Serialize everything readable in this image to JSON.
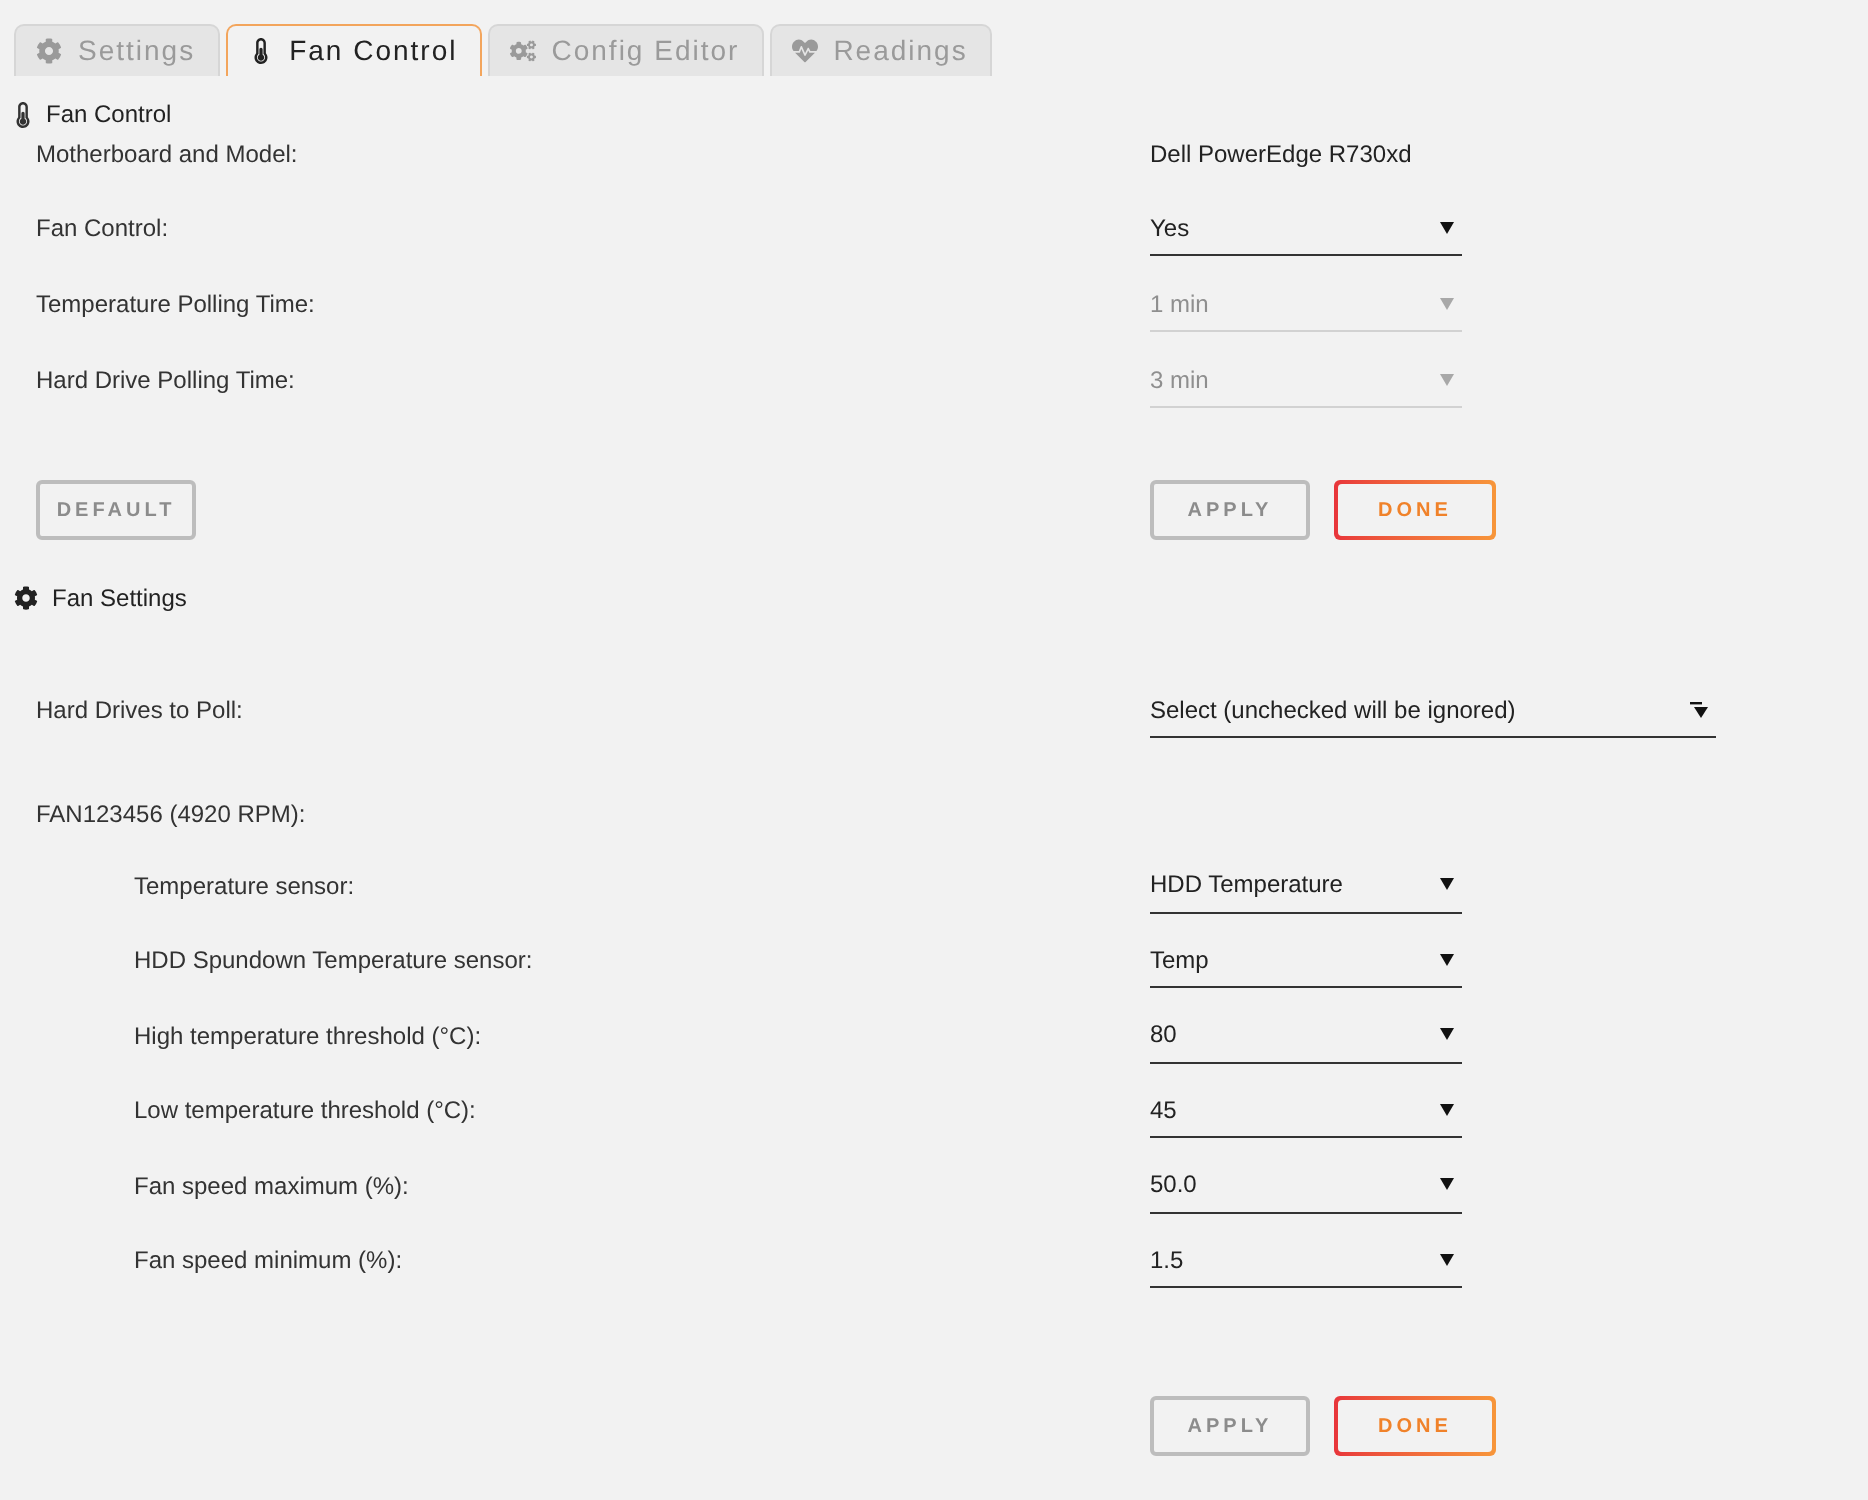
{
  "tabs": [
    {
      "label": "Settings",
      "selected": false
    },
    {
      "label": "Fan Control",
      "selected": true
    },
    {
      "label": "Config Editor",
      "selected": false
    },
    {
      "label": "Readings",
      "selected": false
    }
  ],
  "fan_control": {
    "title": "Fan Control",
    "fields": [
      {
        "kind": "text",
        "label": "Motherboard and Model:",
        "value": "Dell PowerEdge R730xd"
      },
      {
        "kind": "select",
        "label": "Fan Control:",
        "value": "Yes",
        "disabled": false
      },
      {
        "kind": "select",
        "label": "Temperature Polling Time:",
        "value": "1 min",
        "disabled": true
      },
      {
        "kind": "select",
        "label": "Hard Drive Polling Time:",
        "value": "3 min",
        "disabled": true
      }
    ],
    "left_buttons": [
      {
        "label": "DEFAULT",
        "disabled": true
      }
    ],
    "right_buttons": [
      {
        "label": "APPLY",
        "disabled": true
      },
      {
        "label": "DONE",
        "disabled": false
      }
    ]
  },
  "fan_settings": {
    "title": "Fan Settings",
    "hard_drives": {
      "label": "Hard Drives to Poll:",
      "value": "Select (unchecked will be ignored)"
    },
    "fans": [
      {
        "label": "FAN123456 (4920 RPM):",
        "fields": [
          {
            "label": "Temperature sensor:",
            "value": "HDD Temperature"
          },
          {
            "label": "HDD Spundown Temperature sensor:",
            "value": "Temp"
          },
          {
            "label": "High temperature threshold (°C):",
            "value": "80"
          },
          {
            "label": "Low temperature threshold (°C):",
            "value": "45"
          },
          {
            "label": "Fan speed maximum (%):",
            "value": "50.0"
          },
          {
            "label": "Fan speed minimum (%):",
            "value": "1.5"
          }
        ]
      }
    ],
    "buttons": [
      {
        "label": "APPLY",
        "disabled": true
      },
      {
        "label": "DONE",
        "disabled": false
      }
    ]
  }
}
